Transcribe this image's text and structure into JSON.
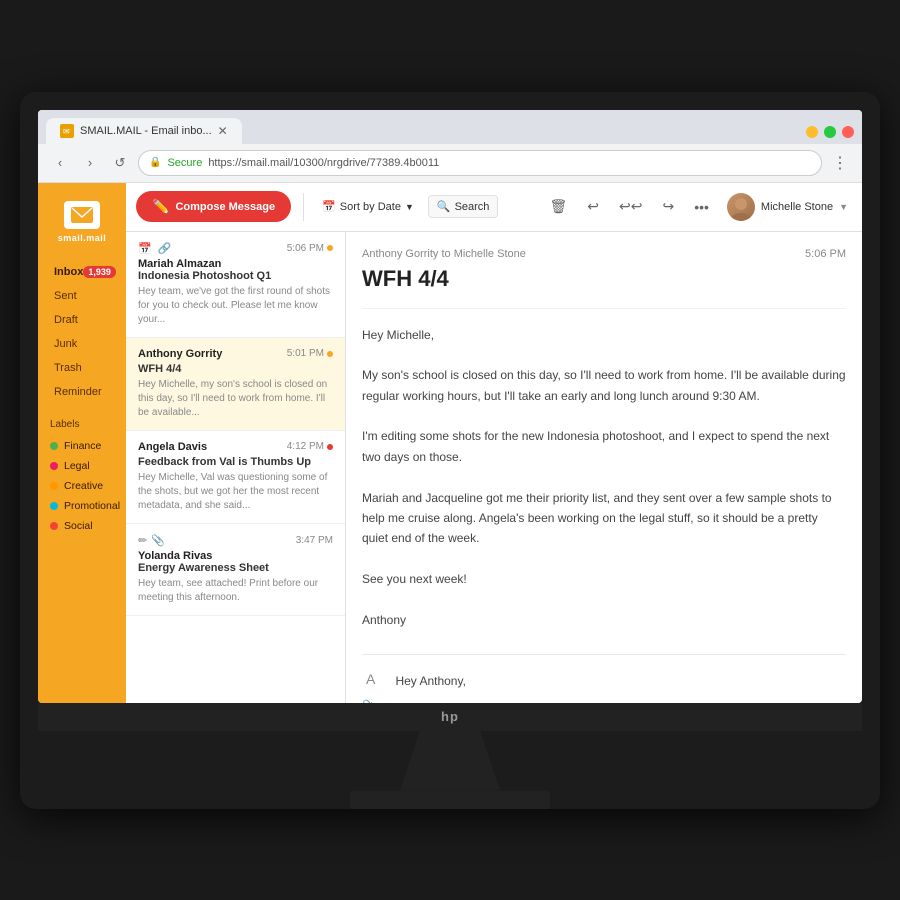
{
  "browser": {
    "tab_title": "SMAIL.MAIL - Email inbo...",
    "url": "https://smail.mail/10300/nrgdrive/77389.4b0011",
    "url_secure_label": "Secure"
  },
  "sidebar": {
    "logo_text": "smail.mail",
    "nav_items": [
      {
        "label": "Inbox",
        "badge": "1,939"
      },
      {
        "label": "Sent",
        "badge": ""
      },
      {
        "label": "Draft",
        "badge": ""
      },
      {
        "label": "Junk",
        "badge": ""
      },
      {
        "label": "Trash",
        "badge": ""
      },
      {
        "label": "Reminder",
        "badge": ""
      }
    ],
    "labels_title": "Labels",
    "labels": [
      {
        "name": "Finance",
        "color": "#4caf50"
      },
      {
        "name": "Legal",
        "color": "#e91e63"
      },
      {
        "name": "Creative",
        "color": "#ff9800"
      },
      {
        "name": "Promotional",
        "color": "#00bcd4"
      },
      {
        "name": "Social",
        "color": "#f44336"
      }
    ]
  },
  "compose": {
    "button_label": "Compose Message"
  },
  "email_list": {
    "sort_label": "Sort by Date",
    "search_label": "Search",
    "emails": [
      {
        "sender": "Mariah Almazan",
        "subject": "Indonesia Photoshoot Q1",
        "preview": "Hey team, we've got the first round of shots for you to check out. Please let me know your...",
        "time": "5:06 PM",
        "unread": true,
        "has_attachment": false
      },
      {
        "sender": "Anthony Gorrity",
        "subject": "WFH 4/4",
        "preview": "Hey Michelle, my son's school is closed on this day, so I'll need to work from home. I'll be available...",
        "time": "5:01 PM",
        "unread": true,
        "has_attachment": false
      },
      {
        "sender": "Angela Davis",
        "subject": "Feedback from Val is Thumbs Up",
        "preview": "Hey Michelle, Val was questioning some of the shots, but we got her the most recent metadata, and she said...",
        "time": "4:12 PM",
        "unread": true,
        "has_attachment": false
      },
      {
        "sender": "Yolanda Rivas",
        "subject": "Energy Awareness Sheet",
        "preview": "Hey team, see attached! Print before our meeting this afternoon.",
        "time": "3:47 PM",
        "unread": false,
        "has_attachment": true
      }
    ]
  },
  "email_view": {
    "toolbar_actions": [
      "delete",
      "undo",
      "reply-all",
      "forward",
      "more"
    ],
    "thread": {
      "from": "Anthony Gorrity to Michelle Stone",
      "time": "5:06 PM",
      "subject": "WFH 4/4",
      "messages": [
        {
          "body": "Hey Michelle,\n\nMy son's school is closed on this day, so I'll need to work from home. I'll be available during regular working hours, but I'll take an early and long lunch around 9:30 AM.\n\nI'm editing some shots for the new Indonesia photoshoot, and I expect to spend the next two days on those.\n\nMariah and Jacqueline got me their priority list, and they sent over a few sample shots to help me cruise along. Angela's been working on the legal stuff, so it should be a pretty quiet end of the week.\n\nSee you next week!\n\nAnthony"
        }
      ],
      "reply": {
        "avatar_letter": "A",
        "body": "Hey Anthony,\n\nFamily first! Make sure you call in for Yolanda's meeting. Angela already told me about the legal stuff, and I'm looking at Mariah's originals, so we're good to go.\n\nThanks!"
      }
    }
  },
  "user": {
    "name": "Michelle Stone"
  }
}
